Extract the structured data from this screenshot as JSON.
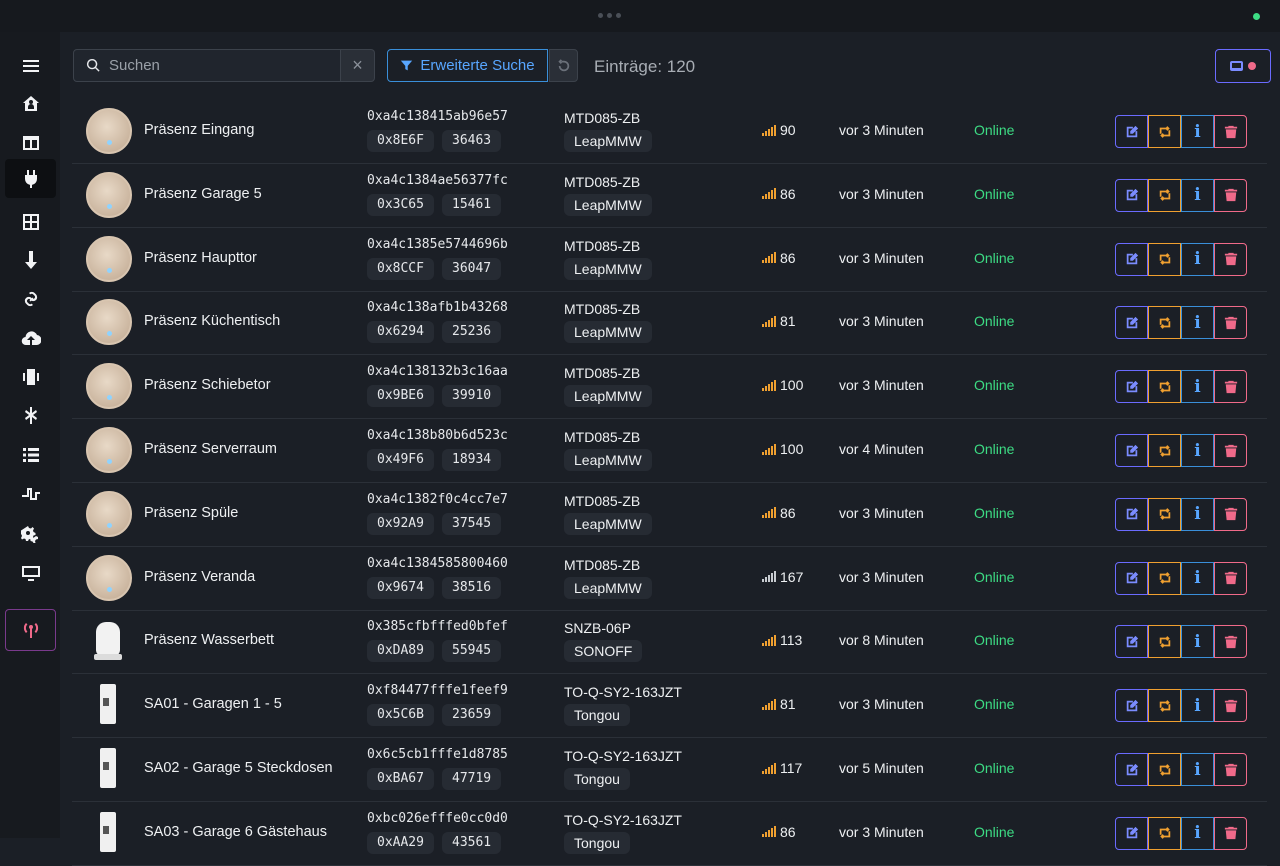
{
  "search": {
    "placeholder": "Suchen",
    "clear_label": "×"
  },
  "toolbar": {
    "advanced_search_label": "Erweiterte Suche",
    "entries_label": "Einträge: 120"
  },
  "sidebar": {
    "items": [
      {
        "icon": "menu-icon"
      },
      {
        "icon": "home-icon"
      },
      {
        "icon": "layout-icon"
      },
      {
        "icon": "plug-icon",
        "active": true
      },
      {
        "icon": "grid-icon"
      },
      {
        "icon": "arrow-down-icon"
      },
      {
        "icon": "link-icon"
      },
      {
        "icon": "cloud-upload-icon"
      },
      {
        "icon": "vibrate-icon"
      },
      {
        "icon": "network-icon"
      },
      {
        "icon": "list-icon"
      },
      {
        "icon": "pulse-icon"
      },
      {
        "icon": "cogs-icon"
      },
      {
        "icon": "monitor-icon"
      },
      {
        "icon": "radio-tower-icon"
      }
    ]
  },
  "devices": [
    {
      "name": "Präsenz Eingang",
      "ieee": "0xa4c138415ab96e57",
      "nwk": "0x8E6F",
      "nwk_dec": "36463",
      "model": "MTD085-ZB",
      "vendor": "LeapMMW",
      "lqi": "90",
      "seen": "vor 3 Minuten",
      "status": "Online",
      "thumb": "presence"
    },
    {
      "name": "Präsenz Garage 5",
      "ieee": "0xa4c1384ae56377fc",
      "nwk": "0x3C65",
      "nwk_dec": "15461",
      "model": "MTD085-ZB",
      "vendor": "LeapMMW",
      "lqi": "86",
      "seen": "vor 3 Minuten",
      "status": "Online",
      "thumb": "presence"
    },
    {
      "name": "Präsenz Haupttor",
      "ieee": "0xa4c1385e5744696b",
      "nwk": "0x8CCF",
      "nwk_dec": "36047",
      "model": "MTD085-ZB",
      "vendor": "LeapMMW",
      "lqi": "86",
      "seen": "vor 3 Minuten",
      "status": "Online",
      "thumb": "presence"
    },
    {
      "name": "Präsenz Küchentisch",
      "ieee": "0xa4c138afb1b43268",
      "nwk": "0x6294",
      "nwk_dec": "25236",
      "model": "MTD085-ZB",
      "vendor": "LeapMMW",
      "lqi": "81",
      "seen": "vor 3 Minuten",
      "status": "Online",
      "thumb": "presence"
    },
    {
      "name": "Präsenz Schiebetor",
      "ieee": "0xa4c138132b3c16aa",
      "nwk": "0x9BE6",
      "nwk_dec": "39910",
      "model": "MTD085-ZB",
      "vendor": "LeapMMW",
      "lqi": "100",
      "seen": "vor 3 Minuten",
      "status": "Online",
      "thumb": "presence"
    },
    {
      "name": "Präsenz Serverraum",
      "ieee": "0xa4c138b80b6d523c",
      "nwk": "0x49F6",
      "nwk_dec": "18934",
      "model": "MTD085-ZB",
      "vendor": "LeapMMW",
      "lqi": "100",
      "seen": "vor 4 Minuten",
      "status": "Online",
      "thumb": "presence"
    },
    {
      "name": "Präsenz Spüle",
      "ieee": "0xa4c1382f0c4cc7e7",
      "nwk": "0x92A9",
      "nwk_dec": "37545",
      "model": "MTD085-ZB",
      "vendor": "LeapMMW",
      "lqi": "86",
      "seen": "vor 3 Minuten",
      "status": "Online",
      "thumb": "presence"
    },
    {
      "name": "Präsenz Veranda",
      "ieee": "0xa4c1384585800460",
      "nwk": "0x9674",
      "nwk_dec": "38516",
      "model": "MTD085-ZB",
      "vendor": "LeapMMW",
      "lqi": "167",
      "seen": "vor 3 Minuten",
      "status": "Online",
      "thumb": "presence",
      "lqi_grey": true
    },
    {
      "name": "Präsenz Wasserbett",
      "ieee": "0x385cfbfffed0bfef",
      "nwk": "0xDA89",
      "nwk_dec": "55945",
      "model": "SNZB-06P",
      "vendor": "SONOFF",
      "lqi": "113",
      "seen": "vor 8 Minuten",
      "status": "Online",
      "thumb": "sonoff"
    },
    {
      "name": "SA01 - Garagen 1 - 5",
      "ieee": "0xf84477fffe1feef9",
      "nwk": "0x5C6B",
      "nwk_dec": "23659",
      "model": "TO-Q-SY2-163JZT",
      "vendor": "Tongou",
      "lqi": "81",
      "seen": "vor 3 Minuten",
      "status": "Online",
      "thumb": "din"
    },
    {
      "name": "SA02 - Garage 5 Steckdosen",
      "ieee": "0x6c5cb1fffe1d8785",
      "nwk": "0xBA67",
      "nwk_dec": "47719",
      "model": "TO-Q-SY2-163JZT",
      "vendor": "Tongou",
      "lqi": "117",
      "seen": "vor 5 Minuten",
      "status": "Online",
      "thumb": "din"
    },
    {
      "name": "SA03 - Garage 6 Gästehaus",
      "ieee": "0xbc026efffe0cc0d0",
      "nwk": "0xAA29",
      "nwk_dec": "43561",
      "model": "TO-Q-SY2-163JZT",
      "vendor": "Tongou",
      "lqi": "86",
      "seen": "vor 3 Minuten",
      "status": "Online",
      "thumb": "din"
    }
  ],
  "colors": {
    "online": "#3ddc84",
    "accent": "#58a6ff",
    "edit": "#7b8cff",
    "reconfigure": "#f0a030",
    "delete": "#f06a8a"
  }
}
